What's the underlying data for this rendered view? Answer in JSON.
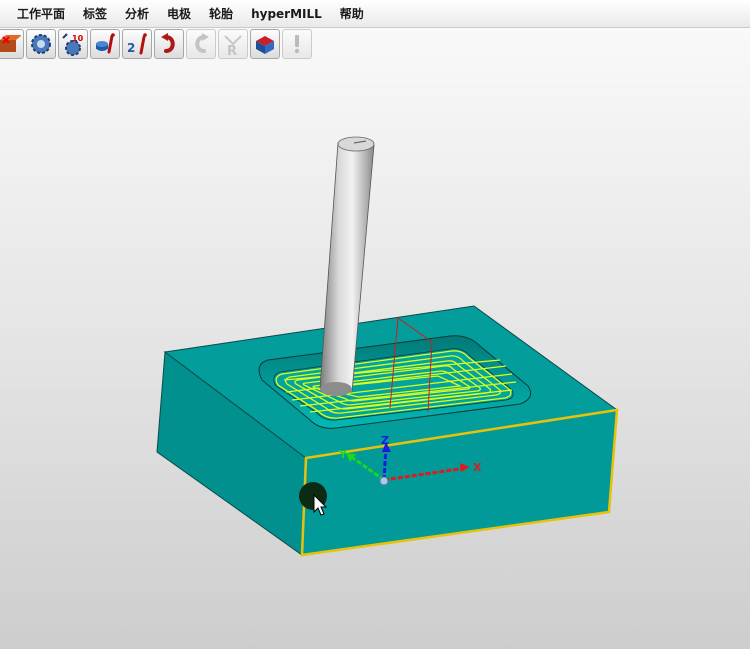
{
  "menu": {
    "items": [
      "工作平面",
      "标签",
      "分析",
      "电极",
      "轮胎",
      "hyperMILL",
      "帮助"
    ]
  },
  "toolbar": {
    "buttons": [
      {
        "icon": "stock-model-icon",
        "enabled": true
      },
      {
        "icon": "gear-settings-icon",
        "enabled": true
      },
      {
        "icon": "job-calculation-icon",
        "badge": "10",
        "enabled": true
      },
      {
        "icon": "info-model-icon",
        "enabled": true
      },
      {
        "icon": "info-compare-icon",
        "badge": "2",
        "enabled": true
      },
      {
        "icon": "undo-icon",
        "enabled": true
      },
      {
        "icon": "redo-icon",
        "enabled": false
      },
      {
        "icon": "reset-icon",
        "enabled": false
      },
      {
        "icon": "solid-box-icon",
        "enabled": true
      },
      {
        "icon": "warning-icon",
        "enabled": false
      }
    ]
  },
  "viewport": {
    "axes": {
      "x": "X",
      "y": "Y",
      "z": "Z"
    },
    "colors": {
      "block": "#029a98",
      "toolpath": "#d8ff1a",
      "highlight_edge": "#e8c20a",
      "x_axis": "#e01a1a",
      "y_axis": "#1bd81b",
      "z_axis": "#1a1ae0"
    }
  }
}
